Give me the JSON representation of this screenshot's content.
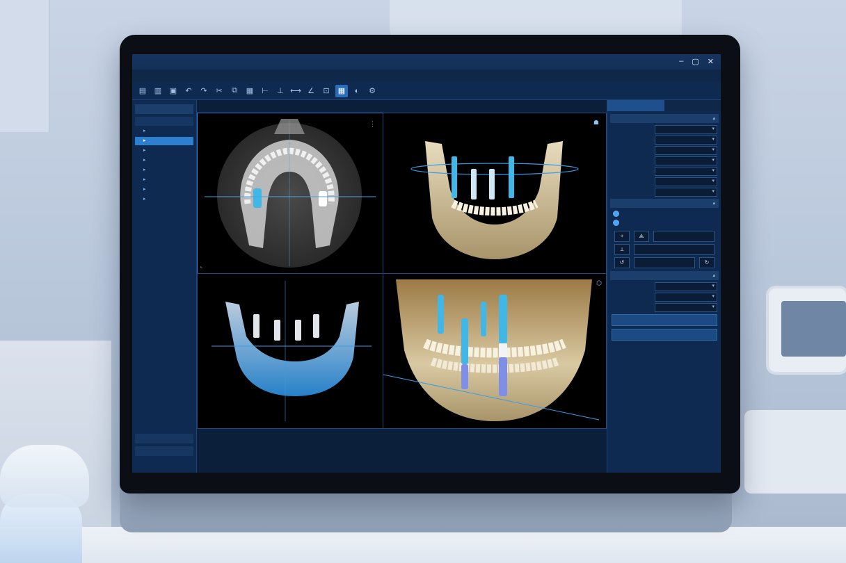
{
  "window": {
    "title": "",
    "status_text": "",
    "controls": [
      "–",
      "▢",
      "✕"
    ]
  },
  "menu": [],
  "toolbar": {
    "icons": [
      "new-icon",
      "open-icon",
      "save-icon",
      "undo-icon",
      "redo-icon",
      "cut-icon",
      "copy-icon",
      "paste-icon",
      "measure-icon",
      "implant-icon",
      "ruler-icon",
      "angle-icon",
      "crop-icon",
      "layout-icon",
      "view-icon",
      "settings-icon"
    ],
    "active_index": 13
  },
  "left_panel": {
    "header": "",
    "sub": "",
    "items": [
      "",
      "",
      "",
      "",
      "",
      "",
      "",
      ""
    ],
    "selected_index": 1,
    "bottom_items": [
      "",
      ""
    ],
    "status": ""
  },
  "viewports": [
    {
      "label": ""
    },
    {
      "label": ""
    },
    {
      "label": ""
    },
    {
      "label": ""
    }
  ],
  "right_panel": {
    "tabs": [
      "",
      ""
    ],
    "section1": {
      "header": "",
      "rows": [
        {
          "label": "",
          "value": ""
        },
        {
          "label": "",
          "value": ""
        },
        {
          "label": "",
          "value": ""
        },
        {
          "label": "",
          "value": ""
        },
        {
          "label": "",
          "value": ""
        },
        {
          "label": "",
          "value": ""
        },
        {
          "label": "",
          "value": ""
        }
      ]
    },
    "section2": {
      "header": "",
      "radio": [
        "",
        ""
      ],
      "cols": [
        "",
        ""
      ]
    },
    "section3": {
      "header": "",
      "rows": [
        {
          "label": "",
          "value": ""
        },
        {
          "label": "",
          "value": ""
        },
        {
          "label": "",
          "value": ""
        }
      ],
      "buttons": [
        "",
        ""
      ]
    },
    "footer": ""
  },
  "colors": {
    "implant": "#41b7e8",
    "implant_tip": "#7f8fe8",
    "accent": "#2d7fcf",
    "bone": "#d9c9a2"
  }
}
